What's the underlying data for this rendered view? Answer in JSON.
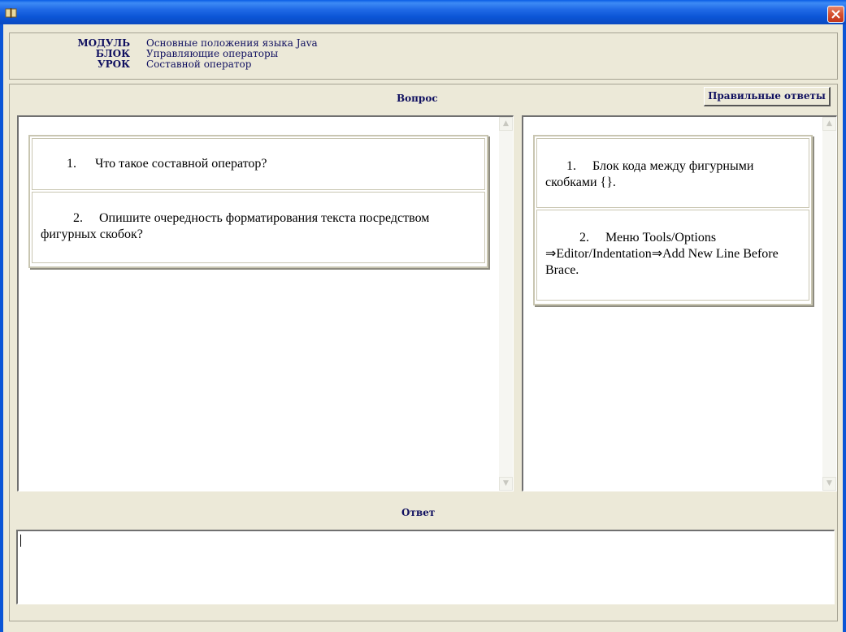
{
  "window": {
    "app_icon": "book-icon",
    "close_icon": "close-icon"
  },
  "header": {
    "labels": [
      "МОДУЛЬ",
      "БЛОК",
      "УРОК"
    ],
    "values": [
      "Основные положения языка Java",
      "Управляющие операторы",
      "Составной оператор"
    ]
  },
  "question_section": {
    "title": "Вопрос",
    "right_answers_button": "Правильные ответы",
    "questions": [
      {
        "num": "1.",
        "text": "Что такое составной оператор?"
      },
      {
        "num": "2.",
        "text": "Опишите очередность форматирования текста посредством фигурных скобок?"
      }
    ],
    "answers": [
      {
        "num": "1.",
        "text": "Блок кода между фигурными скобками {}."
      },
      {
        "num": "2.",
        "text": "Меню Tools/Options ⇒Editor/Indentation⇒Add New Line Before Brace."
      }
    ]
  },
  "answer_section": {
    "title": "Ответ",
    "value": ""
  },
  "colors": {
    "title_bar": "#0b55d6",
    "window_bg": "#ece9d8",
    "label_text": "#101060",
    "close_button": "#d5512f"
  }
}
